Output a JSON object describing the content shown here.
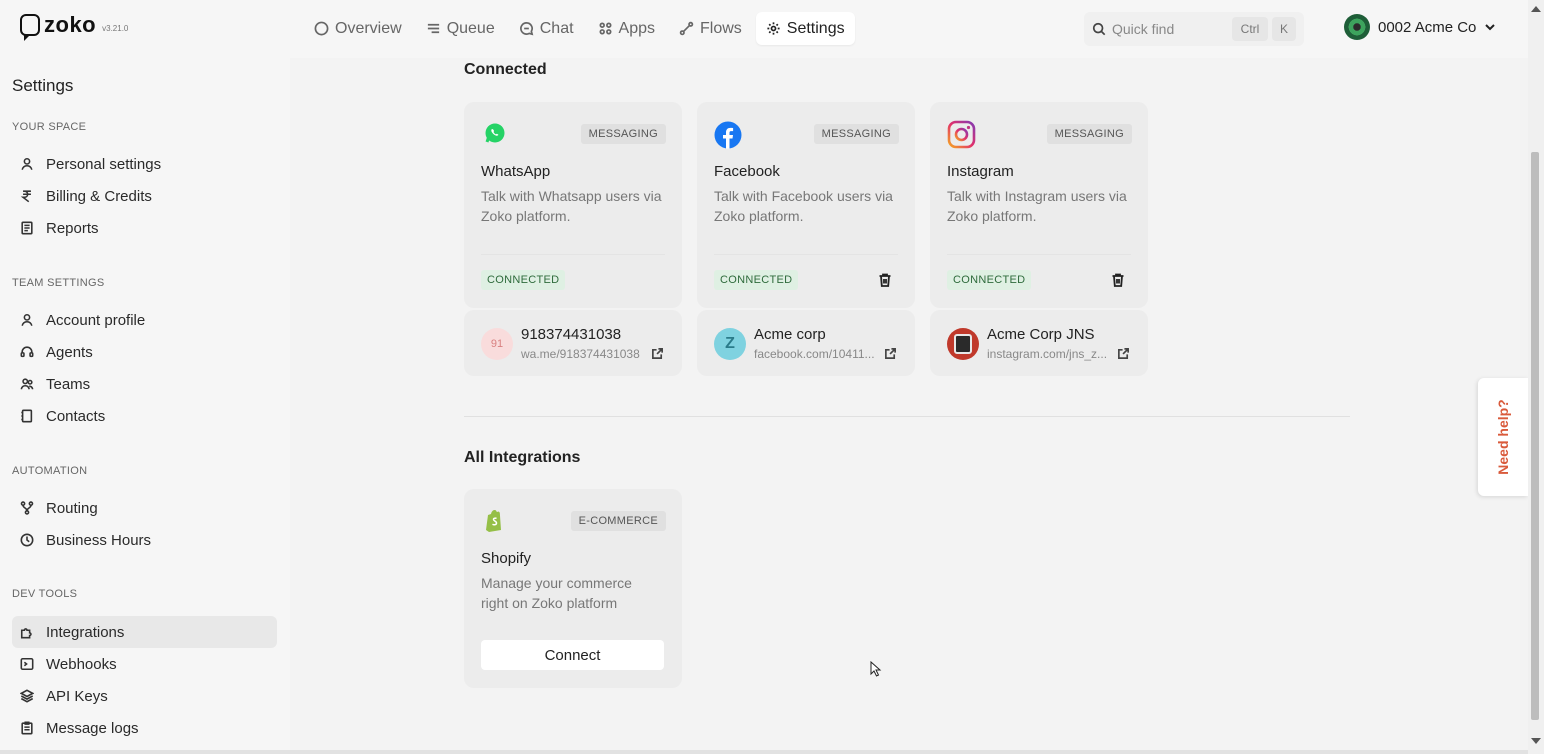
{
  "app": {
    "name": "zoko",
    "version": "v3.21.0"
  },
  "nav": {
    "tabs": [
      {
        "label": "Overview",
        "icon": "circle-icon"
      },
      {
        "label": "Queue",
        "icon": "list-icon"
      },
      {
        "label": "Chat",
        "icon": "chat-icon"
      },
      {
        "label": "Apps",
        "icon": "apps-icon"
      },
      {
        "label": "Flows",
        "icon": "flow-icon"
      },
      {
        "label": "Settings",
        "icon": "gear-icon",
        "active": true
      }
    ]
  },
  "search": {
    "placeholder": "Quick find",
    "shortcut_ctrl": "Ctrl",
    "shortcut_key": "K"
  },
  "org": {
    "name": "0002 Acme Co"
  },
  "sidebar": {
    "title": "Settings",
    "sections": [
      {
        "label": "YOUR SPACE",
        "items": [
          "Personal settings",
          "Billing & Credits",
          "Reports"
        ]
      },
      {
        "label": "TEAM SETTINGS",
        "items": [
          "Account profile",
          "Agents",
          "Teams",
          "Contacts"
        ]
      },
      {
        "label": "AUTOMATION",
        "items": [
          "Routing",
          "Business Hours"
        ]
      },
      {
        "label": "DEV TOOLS",
        "items": [
          "Integrations",
          "Webhooks",
          "API Keys",
          "Message logs"
        ]
      }
    ],
    "active_item": "Integrations"
  },
  "connected": {
    "heading": "Connected",
    "cards": [
      {
        "name": "WhatsApp",
        "badge": "MESSAGING",
        "description": "Talk with Whatsapp users via Zoko platform.",
        "status": "CONNECTED",
        "account": {
          "avatar_text": "91",
          "name": "918374431038",
          "link": "wa.me/918374431038"
        }
      },
      {
        "name": "Facebook",
        "badge": "MESSAGING",
        "description": "Talk with Facebook users via Zoko platform.",
        "status": "CONNECTED",
        "account": {
          "avatar_text": "Z",
          "name": "Acme corp",
          "link": "facebook.com/10411..."
        }
      },
      {
        "name": "Instagram",
        "badge": "MESSAGING",
        "description": "Talk with Instagram users via Zoko platform.",
        "status": "CONNECTED",
        "account": {
          "avatar_text": "",
          "name": "Acme Corp JNS",
          "link": "instagram.com/jns_z..."
        }
      }
    ]
  },
  "integrations": {
    "heading": "All Integrations",
    "cards": [
      {
        "name": "Shopify",
        "badge": "E-COMMERCE",
        "description": "Manage your commerce right on Zoko platform",
        "button": "Connect"
      }
    ]
  },
  "help": {
    "label": "Need help?"
  },
  "colors": {
    "whatsapp": "#25d366",
    "facebook": "#1877f2",
    "shopify": "#95bf47",
    "help": "#d95a3b",
    "status_bg": "#dff0e3",
    "status_text": "#2f6b3c"
  }
}
